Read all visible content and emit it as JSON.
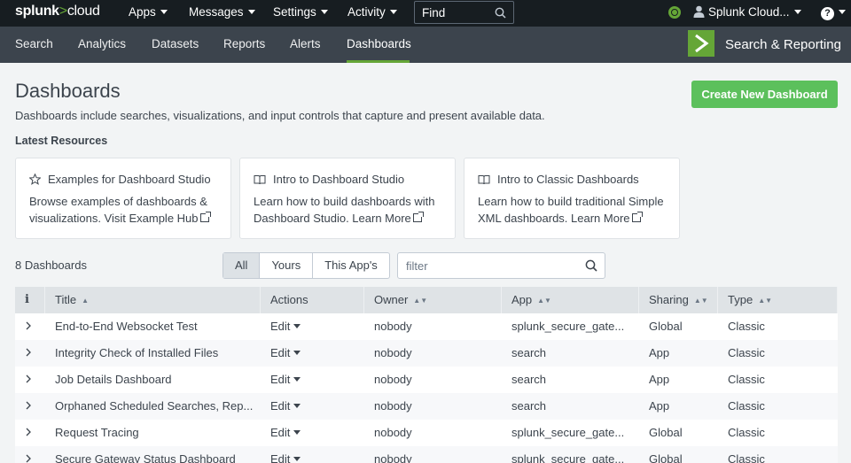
{
  "topnav": {
    "logo_main": "splunk",
    "logo_sep": ">",
    "logo_sub": "cloud",
    "menus": [
      "Apps",
      "Messages",
      "Settings",
      "Activity"
    ],
    "find_placeholder": "Find",
    "user": "Splunk Cloud...",
    "help_glyph": "?"
  },
  "appnav": {
    "items": [
      "Search",
      "Analytics",
      "Datasets",
      "Reports",
      "Alerts",
      "Dashboards"
    ],
    "active": "Dashboards",
    "app_title": "Search & Reporting"
  },
  "page": {
    "title": "Dashboards",
    "description": "Dashboards include searches, visualizations, and input controls that capture and present available data.",
    "create_button": "Create New Dashboard",
    "latest_heading": "Latest Resources"
  },
  "resources": [
    {
      "icon": "star-icon",
      "title": "Examples for Dashboard Studio",
      "line1": "Browse examples of dashboards &",
      "line2": "visualizations. Visit Example Hub"
    },
    {
      "icon": "book-icon",
      "title": "Intro to Dashboard Studio",
      "line1": "Learn how to build dashboards with",
      "line2": "Dashboard Studio. Learn More"
    },
    {
      "icon": "book-icon",
      "title": "Intro to Classic Dashboards",
      "line1": "Learn how to build traditional Simple",
      "line2": "XML dashboards. Learn More"
    }
  ],
  "list": {
    "count_label": "8 Dashboards",
    "tabs": [
      "All",
      "Yours",
      "This App's"
    ],
    "selected_tab": "All",
    "filter_placeholder": "filter"
  },
  "table": {
    "columns": [
      "i",
      "Title",
      "Actions",
      "Owner",
      "App",
      "Sharing",
      "Type"
    ],
    "sort_title": "▲",
    "sort_both": "▲▼",
    "rows": [
      {
        "title": "End-to-End Websocket Test",
        "action": "Edit",
        "owner": "nobody",
        "app": "splunk_secure_gate...",
        "sharing": "Global",
        "type": "Classic"
      },
      {
        "title": "Integrity Check of Installed Files",
        "action": "Edit",
        "owner": "nobody",
        "app": "search",
        "sharing": "App",
        "type": "Classic"
      },
      {
        "title": "Job Details Dashboard",
        "action": "Edit",
        "owner": "nobody",
        "app": "search",
        "sharing": "App",
        "type": "Classic"
      },
      {
        "title": "Orphaned Scheduled Searches, Rep...",
        "action": "Edit",
        "owner": "nobody",
        "app": "search",
        "sharing": "App",
        "type": "Classic"
      },
      {
        "title": "Request Tracing",
        "action": "Edit",
        "owner": "nobody",
        "app": "splunk_secure_gate...",
        "sharing": "Global",
        "type": "Classic"
      },
      {
        "title": "Secure Gateway Status Dashboard",
        "action": "Edit",
        "owner": "nobody",
        "app": "splunk_secure_gate...",
        "sharing": "Global",
        "type": "Classic"
      }
    ]
  },
  "colors": {
    "topbar": "#171d21",
    "appbar": "#3c444d",
    "accent_green": "#65a637",
    "create_button": "#5cc05c"
  }
}
